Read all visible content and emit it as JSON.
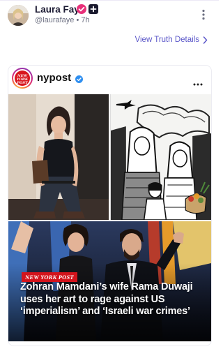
{
  "post": {
    "display_name": "Laura Faye",
    "handle": "@laurafaye",
    "separator": "•",
    "time": "7h",
    "view_details_label": "View Truth Details",
    "icons": {
      "verified": "verified-check-icon",
      "follow": "plus-icon",
      "more": "more-vertical-icon",
      "chevron": "chevron-right-icon"
    },
    "colors": {
      "verified_badge": "#e8307a",
      "link": "#5b57c9"
    }
  },
  "embed": {
    "account_name": "nypost",
    "logo_text": [
      "NEW",
      "YORK",
      "POST"
    ],
    "brand_tag": "NEW YORK POST",
    "headline": "Zohran Mamdani’s wife Rama Duwaji uses her art to rage against US ‘imperialism’ and ‘Israeli war crimes’",
    "icons": {
      "verified": "blue-verified-icon",
      "more": "more-horizontal-icon"
    },
    "colors": {
      "brand_red": "#d3141c"
    }
  }
}
